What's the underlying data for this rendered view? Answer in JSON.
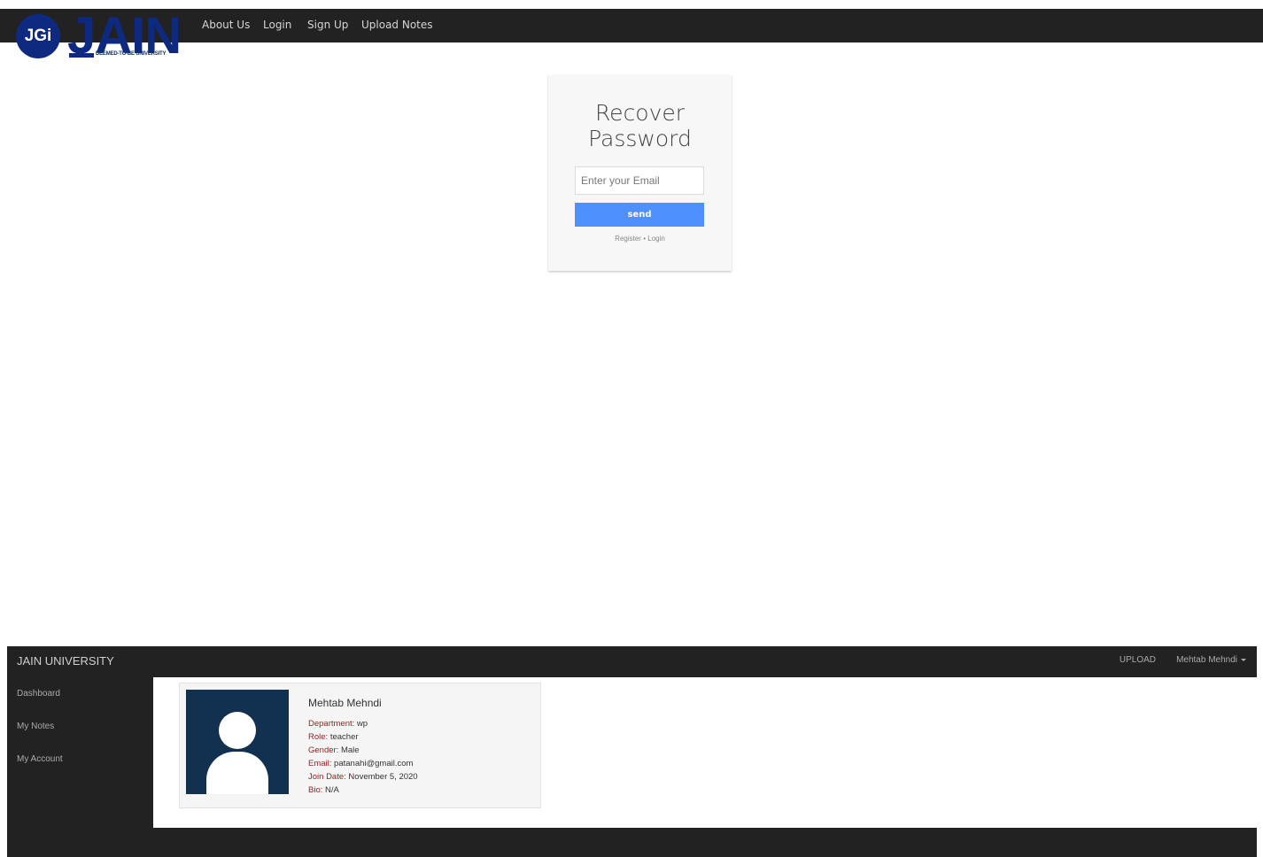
{
  "top_nav": {
    "logo": {
      "circle_text": "JGi",
      "wordmark": "JAIN",
      "tagline": "DEEMED-TO-BE UNIVERSITY"
    },
    "links": [
      "About Us",
      "Login",
      "Sign Up",
      "Upload Notes"
    ]
  },
  "recover": {
    "title_line1": "Recover",
    "title_line2": "Password",
    "email_placeholder": "Enter your Email",
    "send_label": "send",
    "register_link": "Register",
    "separator": "•",
    "login_link": "Login"
  },
  "dashboard": {
    "brand": "JAIN UNIVERSITY",
    "upload_label": "UPLOAD",
    "user_label": "Mehtab Mehndi",
    "sidebar": [
      "Dashboard",
      "My Notes",
      "My Account"
    ],
    "profile": {
      "name": "Mehtab Mehndi",
      "fields": [
        {
          "label": "Department:",
          "value": "wp"
        },
        {
          "label": "Role:",
          "value": "teacher"
        },
        {
          "label": "Gender:",
          "value": "Male"
        },
        {
          "label": "Email:",
          "value": "patanahi@gmail.com"
        },
        {
          "label": "Join Date:",
          "value": "November 5, 2020"
        },
        {
          "label": "Bio:",
          "value": "N/A"
        }
      ]
    }
  },
  "colors": {
    "nav_bg": "#222222",
    "brand_blue": "#0e2a80",
    "send_button": "#4d90fe",
    "field_label": "#a01e1e",
    "avatar_bg": "#12304f"
  }
}
